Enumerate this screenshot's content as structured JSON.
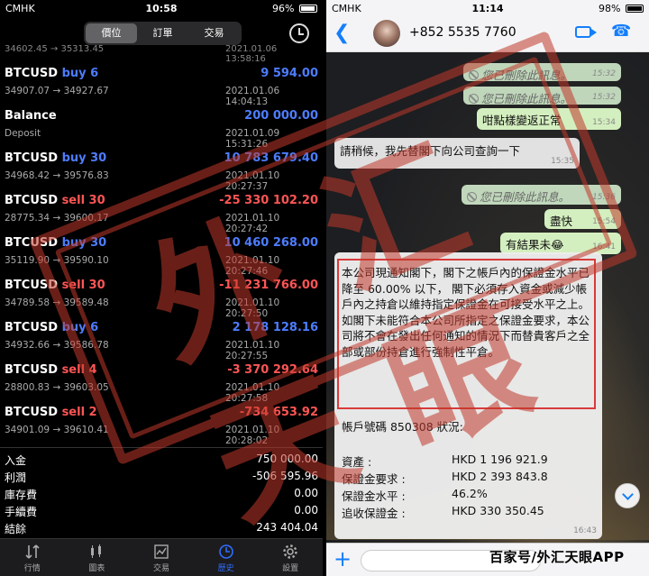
{
  "left": {
    "status": {
      "carrier": "CMHK",
      "time": "10:58",
      "battery": "96%"
    },
    "segments": [
      {
        "label": "價位",
        "active": true
      },
      {
        "label": "訂單",
        "active": false
      },
      {
        "label": "交易",
        "active": false
      }
    ],
    "partial_row": {
      "prices": "34602.45 → 35313.45",
      "date": "2021.01.06 13:58:16"
    },
    "trades": [
      {
        "symbol": "BTCUSD",
        "suffix": "buy 6",
        "side": "buy",
        "prices": "34907.07 → 34927.67",
        "amount": "9 594.00",
        "sign": "pos",
        "date": "2021.01.06 14:04:13"
      },
      {
        "symbol": "Balance",
        "suffix": "",
        "side": "none",
        "prices": "Deposit",
        "amount": "200 000.00",
        "sign": "pos",
        "date": "2021.01.09 15:31:26"
      },
      {
        "symbol": "BTCUSD",
        "suffix": "buy 30",
        "side": "buy",
        "prices": "34968.42 → 39576.83",
        "amount": "10 783 679.40",
        "sign": "pos",
        "date": "2021.01.10 20:27:37"
      },
      {
        "symbol": "BTCUSD",
        "suffix": "sell 30",
        "side": "sell",
        "prices": "28775.34 → 39600.17",
        "amount": "-25 330 102.20",
        "sign": "neg",
        "date": "2021.01.10 20:27:42"
      },
      {
        "symbol": "BTCUSD",
        "suffix": "buy 30",
        "side": "buy",
        "prices": "35119.90 → 39590.10",
        "amount": "10 460 268.00",
        "sign": "pos",
        "date": "2021.01.10 20:27:46"
      },
      {
        "symbol": "BTCUSD",
        "suffix": "sell 30",
        "side": "sell",
        "prices": "34789.58 → 39589.48",
        "amount": "-11 231 766.00",
        "sign": "neg",
        "date": "2021.01.10 20:27:50"
      },
      {
        "symbol": "BTCUSD",
        "suffix": "buy 6",
        "side": "buy",
        "prices": "34932.66 → 39586.78",
        "amount": "2 178 128.16",
        "sign": "pos",
        "date": "2021.01.10 20:27:55"
      },
      {
        "symbol": "BTCUSD",
        "suffix": "sell 4",
        "side": "sell",
        "prices": "28800.83 → 39603.05",
        "amount": "-3 370 292.64",
        "sign": "neg",
        "date": "2021.01.10 20:27:58"
      },
      {
        "symbol": "BTCUSD",
        "suffix": "sell 2",
        "side": "sell",
        "prices": "34901.09 → 39610.41",
        "amount": "-734 653.92",
        "sign": "neg",
        "date": "2021.01.10 20:28:02"
      }
    ],
    "summary": [
      {
        "label": "入金",
        "value": "750 000.00"
      },
      {
        "label": "利潤",
        "value": "-506 595.96"
      },
      {
        "label": "庫存費",
        "value": "0.00"
      },
      {
        "label": "手續費",
        "value": "0.00"
      },
      {
        "label": "結餘",
        "value": "243 404.04"
      }
    ],
    "tabs": [
      {
        "label": "行情",
        "icon": "quotes-icon",
        "active": false
      },
      {
        "label": "圖表",
        "icon": "chart-icon",
        "active": false
      },
      {
        "label": "交易",
        "icon": "trade-icon",
        "active": false
      },
      {
        "label": "歷史",
        "icon": "history-icon",
        "active": true
      },
      {
        "label": "設置",
        "icon": "settings-icon",
        "active": false
      }
    ]
  },
  "right": {
    "status": {
      "carrier": "CMHK",
      "time": "11:14",
      "battery": "98%"
    },
    "contact": "+852 5535 7760",
    "messages": [
      {
        "dir": "del",
        "text": "您已刪除此訊息。",
        "time": "15:32"
      },
      {
        "dir": "del",
        "text": "您已刪除此訊息。",
        "time": "15:32"
      },
      {
        "dir": "out",
        "text": "咁點樣變返正常",
        "time": "15:34"
      },
      {
        "dir": "in",
        "text": "請稍候，我先替閣下向公司查詢一下",
        "time": "15:35"
      },
      {
        "dir": "del",
        "text": "您已刪除此訊息。",
        "time": "15:36"
      },
      {
        "dir": "out",
        "text": "盡快",
        "time": "15:54"
      },
      {
        "dir": "out",
        "text": "有結果未😂",
        "time": "16:41"
      }
    ],
    "notice": {
      "para1": "本公司現通知閣下，閣下之帳戶內的保證金水平已降至 60.00% 以下， 閣下必須存入資金或減少帳戶內之持倉以維持指定保證金在可接受水平之上。",
      "para2": "如閣下未能符合本公司所指定之保證金要求，本公司將不會在發出任何通知的情況下而替貴客戶之全部或部份持倉進行強制性平倉。",
      "account": "帳戶號碼 850308 狀況:",
      "rows": [
        {
          "label": "資產      :",
          "value": "HKD 1 196 921.9"
        },
        {
          "label": "保證金要求    :",
          "value": "HKD 2 393 843.8"
        },
        {
          "label": "保證金水平    :",
          "value": "46.2%"
        },
        {
          "label": "追收保證金    :",
          "value": "HKD 330 350.45"
        }
      ],
      "time": "16:43"
    },
    "watermark": "百家号/外汇天眼APP"
  },
  "stamp_text": "外汇天眼"
}
